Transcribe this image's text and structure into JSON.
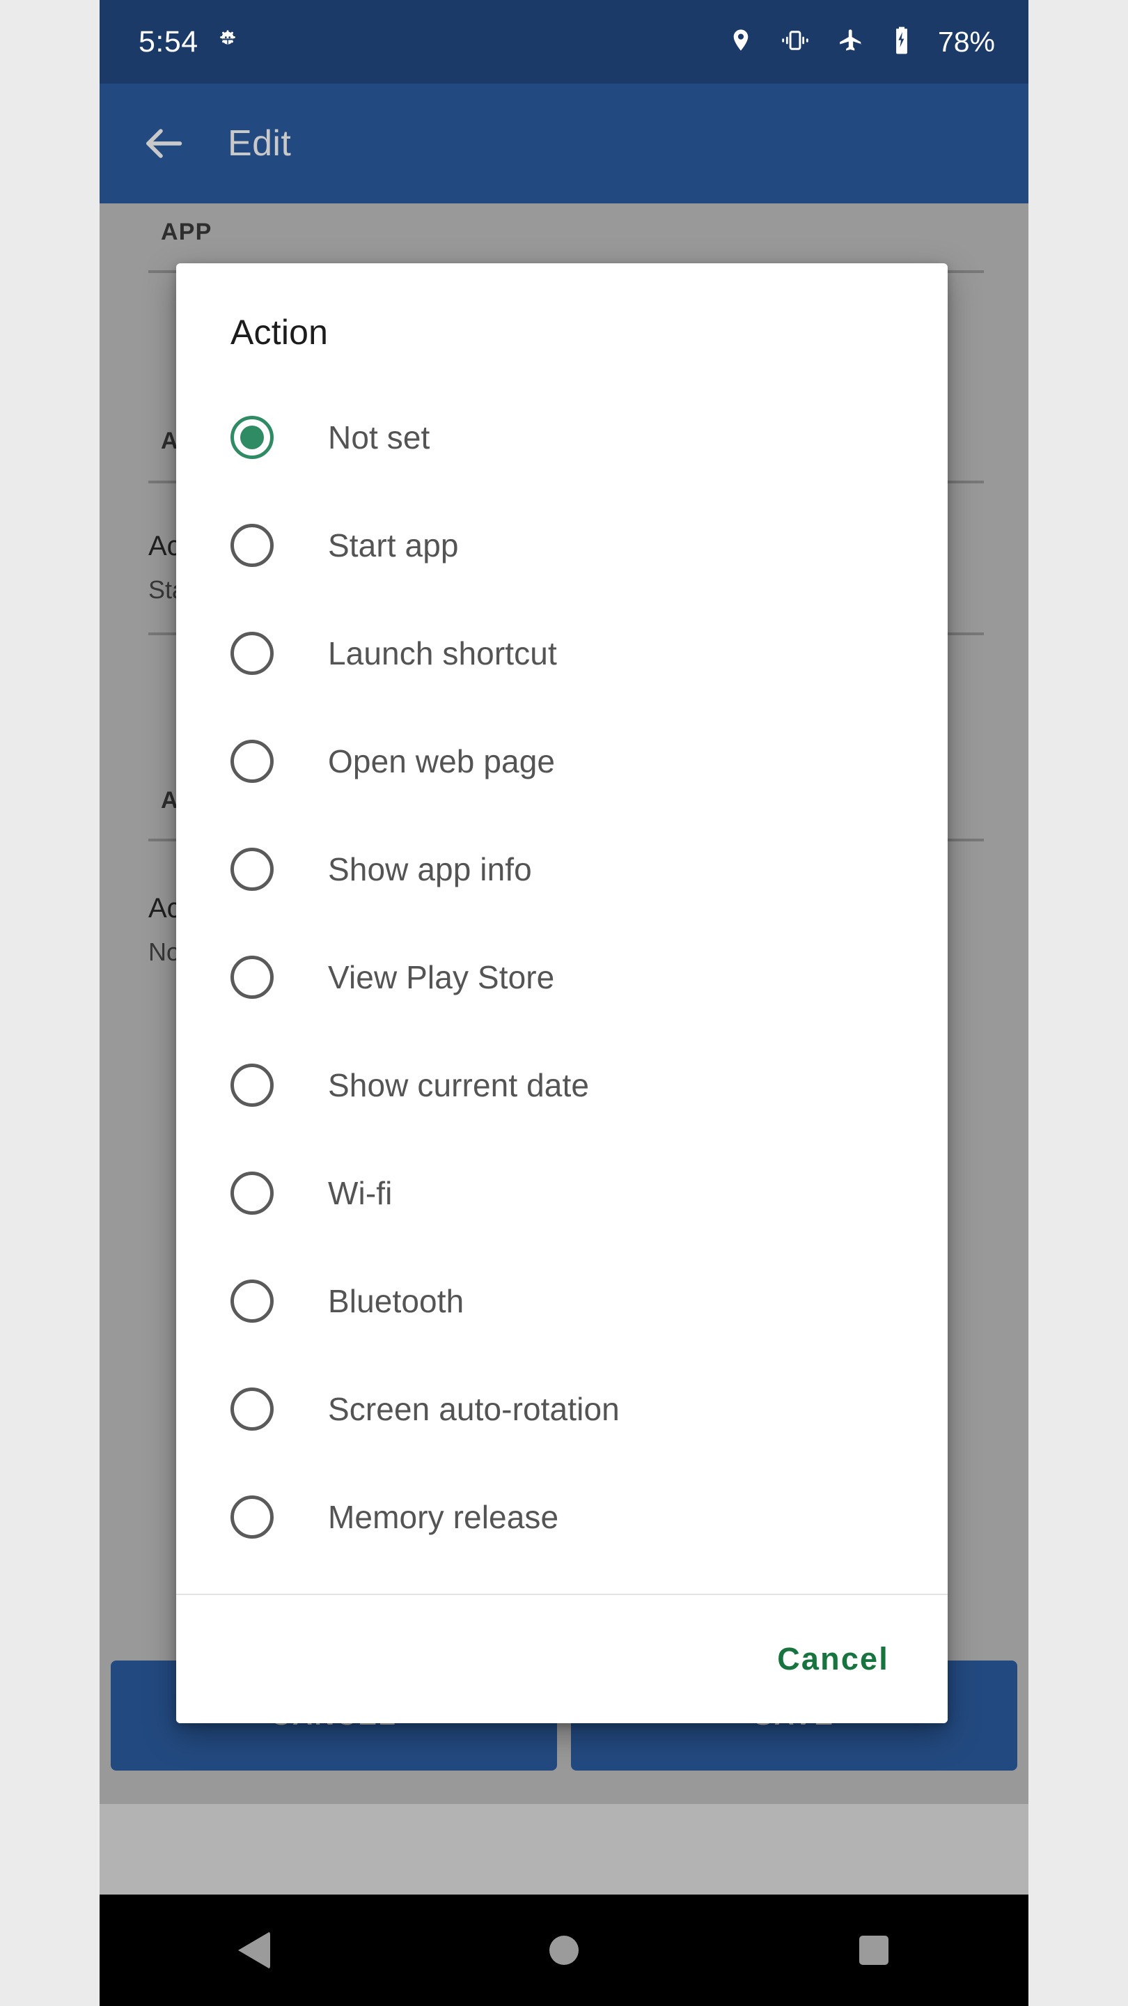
{
  "status_bar": {
    "time": "5:54",
    "developer_icon": "gear-icon",
    "icons": [
      "location-pin-icon",
      "vibrate-icon",
      "airplane-mode-icon",
      "battery-charging-icon"
    ],
    "battery_percent": "78%"
  },
  "toolbar": {
    "back_icon": "back-arrow-icon",
    "title": "Edit"
  },
  "background_screen": {
    "section_header_app": "APP",
    "section_header_2": "A",
    "section_header_3": "A",
    "row1_title": "Ac",
    "row1_subtitle": "Sta",
    "row2_title": "Ac",
    "row2_subtitle": "No",
    "cancel_label": "CANCEL",
    "save_label": "SAVE"
  },
  "dialog": {
    "title": "Action",
    "selected_index": 0,
    "options": [
      {
        "label": "Not set",
        "selected": true
      },
      {
        "label": "Start app",
        "selected": false
      },
      {
        "label": "Launch shortcut",
        "selected": false
      },
      {
        "label": "Open web page",
        "selected": false
      },
      {
        "label": "Show app info",
        "selected": false
      },
      {
        "label": "View Play Store",
        "selected": false
      },
      {
        "label": "Show current date",
        "selected": false
      },
      {
        "label": "Wi-fi",
        "selected": false
      },
      {
        "label": "Bluetooth",
        "selected": false
      },
      {
        "label": "Screen auto-rotation",
        "selected": false
      },
      {
        "label": "Memory release",
        "selected": false
      },
      {
        "label": "",
        "selected": false
      }
    ],
    "cancel_label": "Cancel"
  },
  "navigation_bar": {
    "back": "nav-back-icon",
    "home": "nav-home-icon",
    "recents": "nav-recents-icon"
  },
  "colors": {
    "status_bar": "#1b3a68",
    "toolbar": "#234a80",
    "accent_green": "#2e8b64",
    "cancel_green": "#17743f",
    "page_background": "#ebebeb",
    "dialog_background": "#ffffff"
  }
}
